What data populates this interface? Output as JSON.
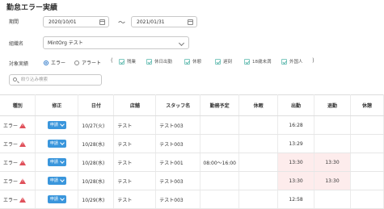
{
  "page": {
    "title": "勤怠エラー実績"
  },
  "filters": {
    "period_label": "期間",
    "start_date": "2020/10/01",
    "tilde": "〜",
    "end_date": "2021/01/31",
    "org_label": "組織名",
    "org_value": "MintOrg テスト",
    "target_label": "対象実績",
    "radio_error": "エラー",
    "radio_alert": "アラート",
    "paren_open": "(",
    "paren_close": ")",
    "checkboxes": [
      "残業",
      "休日出勤",
      "休憩",
      "遅刻",
      "18歳未満",
      "外国人"
    ],
    "search_placeholder": "絞り込み検索"
  },
  "table": {
    "headers": [
      "種別",
      "修正",
      "日付",
      "店舗",
      "スタッフ名",
      "勤務予定",
      "休暇",
      "出勤",
      "退勤",
      "休憩"
    ],
    "edit_button_label": "申請",
    "rows": [
      {
        "type": "エラー",
        "date": "10/27(火)",
        "store": "テスト",
        "staff": "テスト003",
        "schedule": "",
        "leave": "",
        "in": "16:28",
        "out": ""
      },
      {
        "type": "エラー",
        "date": "10/28(水)",
        "store": "テスト",
        "staff": "テスト003",
        "schedule": "",
        "leave": "",
        "in": "13:29",
        "out": ""
      },
      {
        "type": "エラー",
        "date": "10/28(水)",
        "store": "テスト",
        "staff": "テスト001",
        "schedule": "08:00〜16:00",
        "leave": "",
        "in": "13:30",
        "out": "13:30"
      },
      {
        "type": "エラー",
        "date": "10/28(水)",
        "store": "テスト",
        "staff": "テスト003",
        "schedule": "",
        "leave": "",
        "in": "13:30",
        "out": "13:30"
      },
      {
        "type": "エラー",
        "date": "10/29(木)",
        "store": "テスト",
        "staff": "テスト003",
        "schedule": "",
        "leave": "",
        "in": "12:58",
        "out": ""
      }
    ]
  },
  "colors": {
    "accent": "#3a96dc",
    "error": "#e0505a",
    "highlight": "#fdecec",
    "check": "#5bb5aa"
  }
}
